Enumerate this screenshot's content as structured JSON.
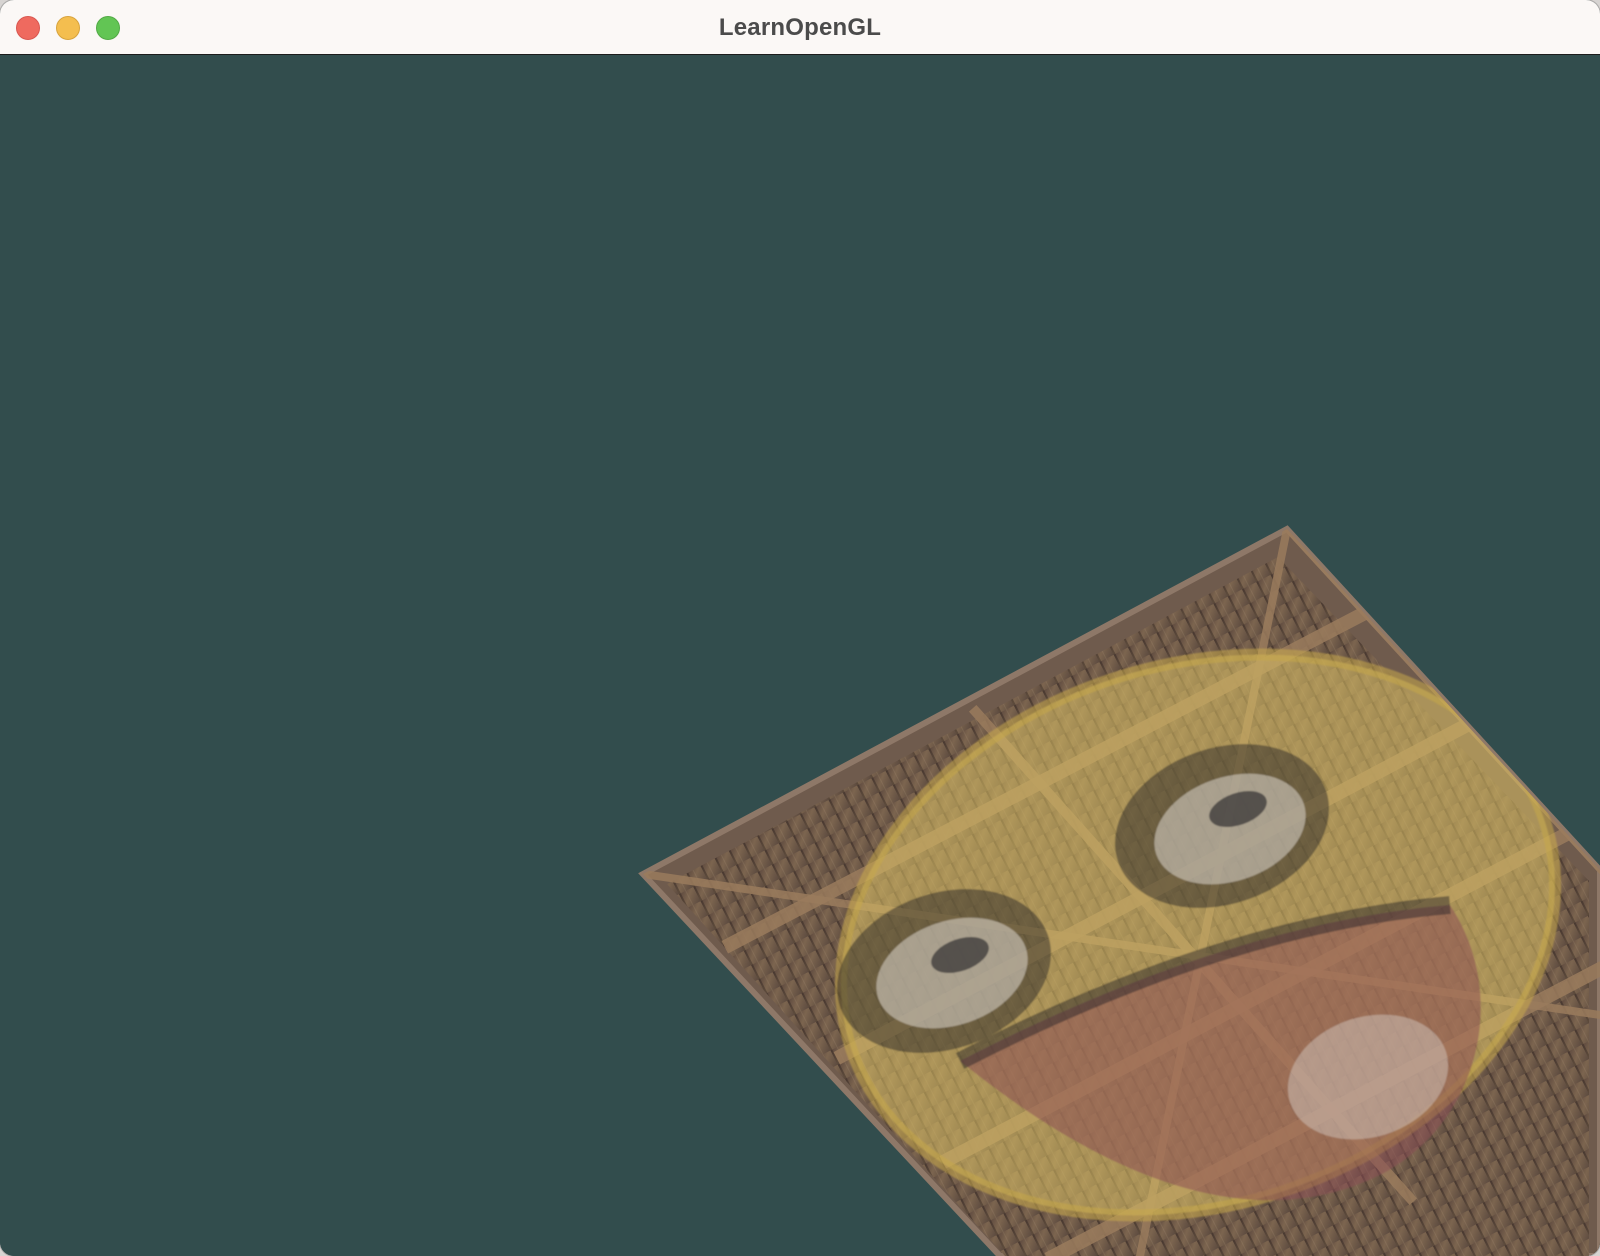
{
  "window": {
    "title": "LearnOpenGL",
    "background_color": "#324d4d",
    "titlebar_color": "#fbf8f6"
  },
  "controls": {
    "close": "close-button",
    "minimize": "minimize-button",
    "maximize": "maximize-button"
  },
  "scene": {
    "object": "textured-quad",
    "texture_1": "wooden-container",
    "texture_2": "awesomeface",
    "colors": {
      "wood_dark": "#4b3b35",
      "wood_mid": "#6e5949",
      "wood_light": "#9a7e60",
      "overlay_yellow": "#d8bd63",
      "overlay_red": "#8a4c55",
      "eye_white": "#d8cec7"
    }
  }
}
